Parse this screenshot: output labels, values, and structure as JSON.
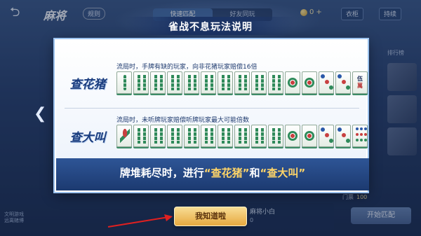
{
  "topbar": {
    "game_title": "麻将",
    "rules_tag": "规则",
    "mode_tabs": [
      "快速匹配",
      "好友同玩"
    ],
    "coins": "0",
    "coins_plus": "+",
    "wardrobe": "衣柜",
    "bag": "持续"
  },
  "sidebar": {
    "leaderboard": "排行榜"
  },
  "modal": {
    "title": "雀战不息玩法说明",
    "section1": {
      "label": "查花猪",
      "text": "流局时，手牌有缺的玩家，向非花猪玩家赔偿16倍"
    },
    "section2": {
      "label": "查大叫",
      "text": "流局时，未听牌玩家赔偿听牌玩家最大可能倍数"
    },
    "tip_prefix": "牌堆耗尽时，进行",
    "tip_q1": "“查花猪”",
    "tip_mid": "和",
    "tip_q2": "“查大叫”",
    "confirm_label": "我知道啦",
    "tile_wan_num": "伍",
    "tile_wan_char": "萬"
  },
  "bottom": {
    "left_text_1": "文明游戏",
    "left_text_2": "远离赌博",
    "player_name": "麻将小白",
    "player_value": "0",
    "tickets_label": "门票",
    "tickets_value": "100",
    "start_match": "开始匹配"
  },
  "colors": {
    "accent_gold": "#ffd568",
    "modal_band": "#1c3a70",
    "button_gold": "#e7a93f"
  }
}
